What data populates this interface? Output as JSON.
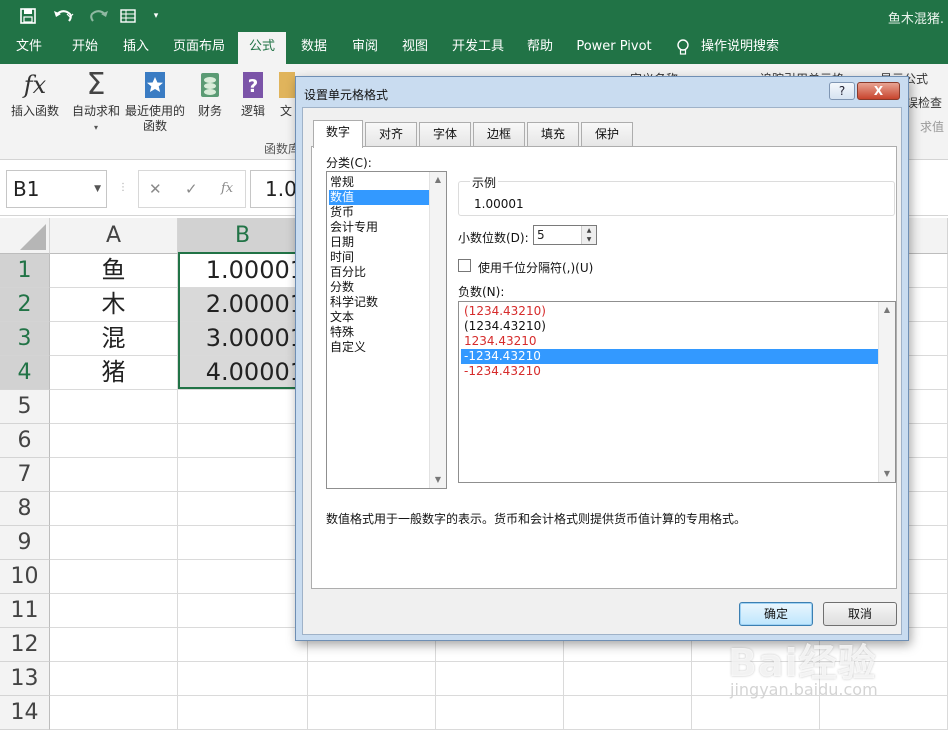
{
  "window": {
    "title": "鱼木混猪."
  },
  "quick_access": {
    "save_icon": "save-icon",
    "undo_icon": "undo-icon",
    "redo_icon": "redo-icon",
    "form_icon": "form-icon",
    "customize_icon": "chevron-down-icon"
  },
  "ribbon_tabs": [
    "文件",
    "开始",
    "插入",
    "页面布局",
    "公式",
    "数据",
    "审阅",
    "视图",
    "开发工具",
    "帮助",
    "Power Pivot",
    "操作说明搜索"
  ],
  "ribbon_active_tab": "公式",
  "ribbon": {
    "insert_function": "插入函数",
    "autosum": "自动求和",
    "recent_line1": "最近使用的",
    "recent_line2": "函数",
    "financial": "财务",
    "logical": "逻辑",
    "text_partial": "文",
    "group_label": "函数库",
    "defined_names": "定义名称",
    "trace_precedents": "追踪引用单元格",
    "show_formulas": "显示公式",
    "error_checking": "误检查",
    "evaluate": "求值",
    "accent": "#217346"
  },
  "formula_bar": {
    "name_box": "B1",
    "formula_value": "1.0"
  },
  "grid": {
    "columns": [
      "A",
      "B"
    ],
    "rows": [
      "1",
      "2",
      "3",
      "4",
      "5",
      "6",
      "7",
      "8",
      "9",
      "10",
      "11",
      "12",
      "13",
      "14"
    ],
    "col_a": [
      "鱼",
      "木",
      "混",
      "猪"
    ],
    "col_b": [
      "1.00001",
      "2.00001",
      "3.00001",
      "4.00001"
    ]
  },
  "dialog": {
    "title": "设置单元格格式",
    "help": "?",
    "close": "X",
    "tabs": [
      "数字",
      "对齐",
      "字体",
      "边框",
      "填充",
      "保护"
    ],
    "active_tab": "数字",
    "category_label": "分类(C):",
    "categories": [
      "常规",
      "数值",
      "货币",
      "会计专用",
      "日期",
      "时间",
      "百分比",
      "分数",
      "科学记数",
      "文本",
      "特殊",
      "自定义"
    ],
    "selected_category": "数值",
    "sample_label": "示例",
    "sample_value": "1.00001",
    "decimal_label": "小数位数(D):",
    "decimal_value": "5",
    "thousands_label": "使用千位分隔符(,)(U)",
    "thousands_checked": false,
    "negative_label": "负数(N):",
    "negative_formats": [
      {
        "text": "(1234.43210)",
        "color": "#d62b2b"
      },
      {
        "text": "(1234.43210)",
        "color": "#111111"
      },
      {
        "text": "1234.43210",
        "color": "#d62b2b"
      },
      {
        "text": "-1234.43210",
        "color": "#ffffff"
      },
      {
        "text": "-1234.43210",
        "color": "#d62b2b"
      }
    ],
    "selected_negative_index": 3,
    "description": "数值格式用于一般数字的表示。货币和会计格式则提供货币值计算的专用格式。",
    "ok": "确定",
    "cancel": "取消",
    "selection_color": "#3399ff"
  },
  "watermark": {
    "logo": "Bai经验",
    "url": "jingyan.baidu.com"
  }
}
